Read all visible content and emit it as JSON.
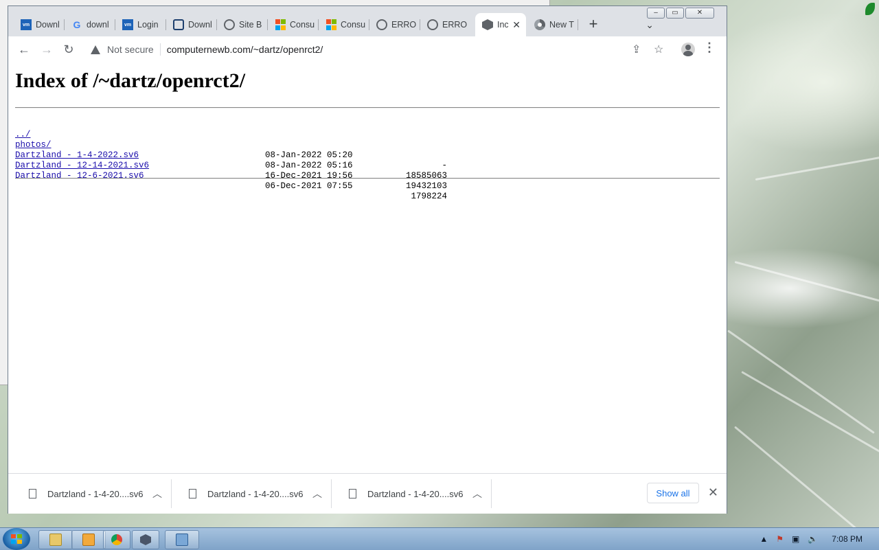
{
  "tabs": [
    {
      "label": "Downl",
      "icon": "vmware-icon"
    },
    {
      "label": "downl",
      "icon": "google-icon"
    },
    {
      "label": "Login",
      "icon": "vmware-icon"
    },
    {
      "label": "Downl",
      "icon": "download-site-icon"
    },
    {
      "label": "Site B",
      "icon": "globe-icon"
    },
    {
      "label": "Consu",
      "icon": "microsoft-icon"
    },
    {
      "label": "Consu",
      "icon": "microsoft-icon"
    },
    {
      "label": "ERROF",
      "icon": "globe-icon"
    },
    {
      "label": "ERROF",
      "icon": "globe-icon"
    },
    {
      "label": "Inc",
      "icon": "dotnet-icon",
      "active": true
    },
    {
      "label": "New T",
      "icon": "chrome-icon"
    }
  ],
  "window_buttons": {
    "minimize": "–",
    "restore": "▭",
    "close": "✕"
  },
  "toolbar": {
    "security_label": "Not secure",
    "url": "computernewb.com/~dartz/openrct2/"
  },
  "page": {
    "title": "Index of /~dartz/openrct2/",
    "entries": [
      {
        "name": "../",
        "date": "",
        "size": ""
      },
      {
        "name": "photos/",
        "date": "08-Jan-2022 05:20",
        "size": "-"
      },
      {
        "name": "Dartzland - 1-4-2022.sv6",
        "date": "08-Jan-2022 05:16",
        "size": "18585063"
      },
      {
        "name": "Dartzland - 12-14-2021.sv6",
        "date": "16-Dec-2021 19:56",
        "size": "19432103"
      },
      {
        "name": "Dartzland - 12-6-2021.sv6",
        "date": "06-Dec-2021 07:55",
        "size": "1798224"
      }
    ]
  },
  "downloads": {
    "items": [
      {
        "name": "Dartzland - 1-4-20....sv6"
      },
      {
        "name": "Dartzland - 1-4-20....sv6"
      },
      {
        "name": "Dartzland - 1-4-20....sv6"
      }
    ],
    "show_all": "Show all"
  },
  "taskbar": {
    "clock": "7:08 PM"
  }
}
